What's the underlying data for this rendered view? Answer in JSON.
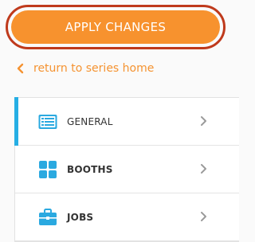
{
  "apply_button": {
    "label": "APPLY CHANGES"
  },
  "back_link": {
    "label": "return to series home"
  },
  "menu": {
    "items": [
      {
        "label": "GENERAL",
        "icon": "list-icon",
        "active": true
      },
      {
        "label": "BOOTHS",
        "icon": "grid-icon",
        "active": false
      },
      {
        "label": "JOBS",
        "icon": "briefcase-icon",
        "active": false
      }
    ]
  },
  "colors": {
    "accent_orange": "#f7922e",
    "outline_red": "#bf3a1c",
    "active_blue": "#25aee4",
    "icon_blue": "#2aa9e0"
  }
}
